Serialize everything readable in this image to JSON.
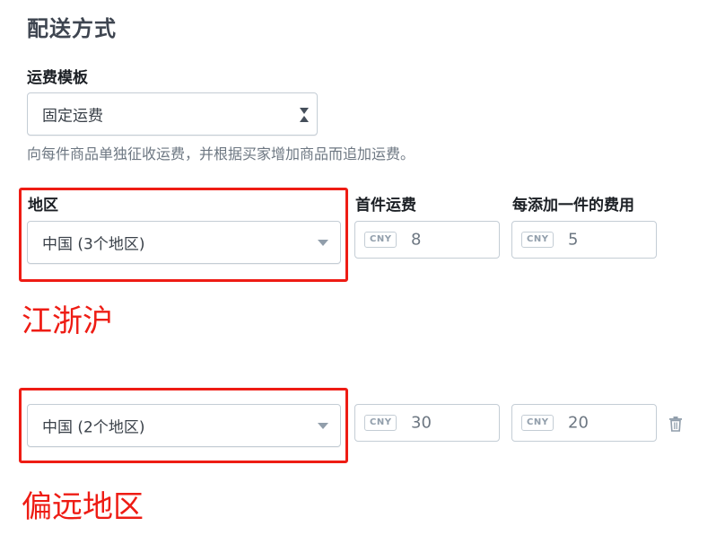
{
  "section": {
    "title": "配送方式"
  },
  "template": {
    "label": "运费模板",
    "selected": "固定运费",
    "help": "向每件商品单独征收运费，并根据买家增加商品而追加运费。"
  },
  "columns": {
    "region": "地区",
    "first_fee": "首件运费",
    "additional_fee": "每添加一件的费用"
  },
  "currency": "CNY",
  "rows": [
    {
      "region": "中国 (3个地区)",
      "first_fee": "8",
      "additional_fee": "5",
      "annotation": "江浙沪"
    },
    {
      "region": "中国 (2个地区)",
      "first_fee": "30",
      "additional_fee": "20",
      "annotation": "偏远地区"
    }
  ],
  "colors": {
    "annotation_red": "#ee1c14",
    "border": "#c4cdd5",
    "muted_text": "#6d7782"
  },
  "icons": {
    "delete": "trash-icon",
    "dropdown": "caret-down-icon",
    "template_dropdown": "up-down-arrows-icon"
  }
}
